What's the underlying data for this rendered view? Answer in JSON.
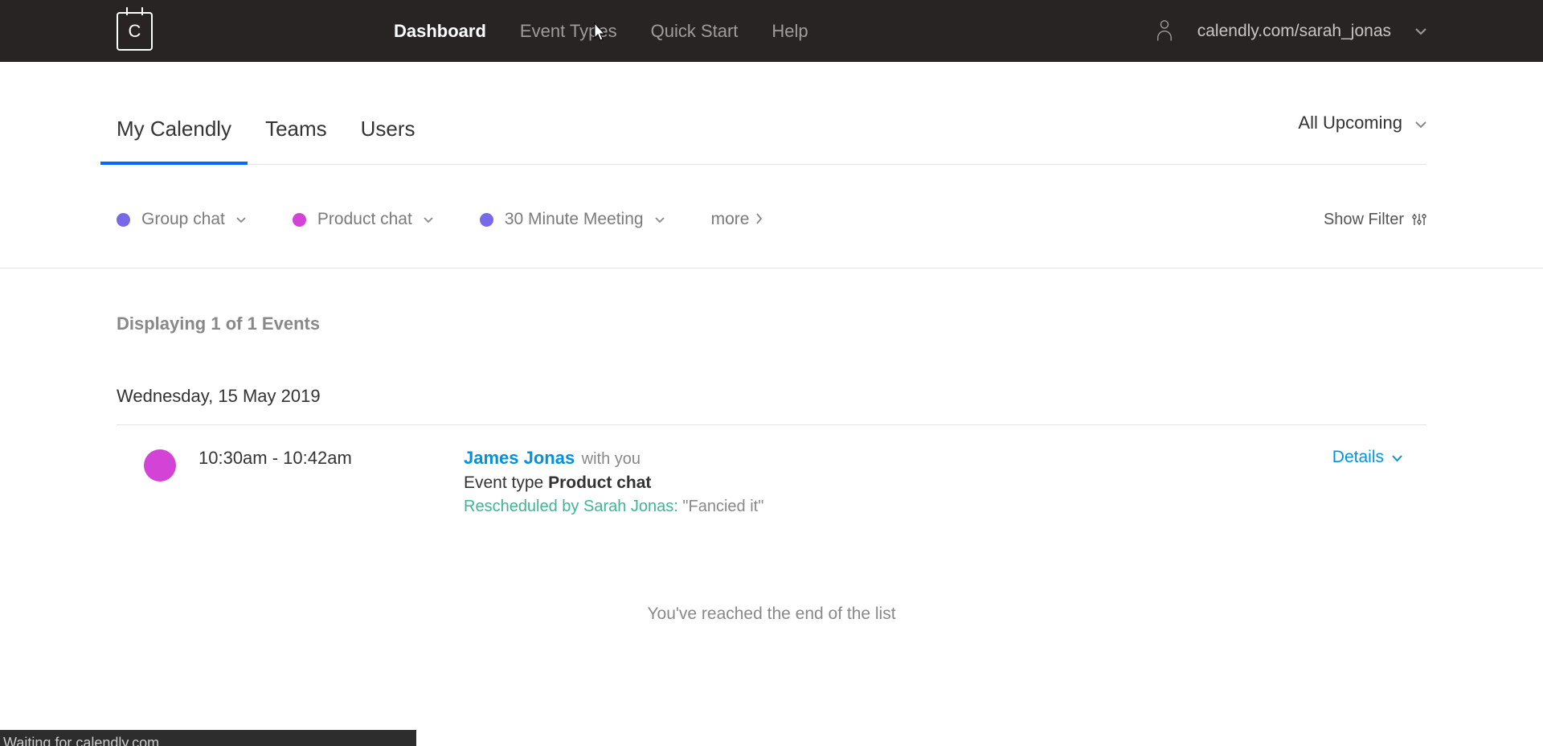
{
  "header": {
    "logo_letter": "C",
    "nav": [
      {
        "label": "Dashboard",
        "active": true
      },
      {
        "label": "Event Types",
        "active": false
      },
      {
        "label": "Quick Start",
        "active": false
      },
      {
        "label": "Help",
        "active": false
      }
    ],
    "user_url": "calendly.com/sarah_jonas"
  },
  "tabs": [
    {
      "label": "My Calendly",
      "active": true
    },
    {
      "label": "Teams",
      "active": false
    },
    {
      "label": "Users",
      "active": false
    }
  ],
  "range_filter": "All Upcoming",
  "event_types": [
    {
      "label": "Group chat",
      "color": "purple"
    },
    {
      "label": "Product chat",
      "color": "magenta"
    },
    {
      "label": "30 Minute Meeting",
      "color": "purple"
    }
  ],
  "more_label": "more",
  "show_filter_label": "Show Filter",
  "display_count_text": "Displaying 1 of 1 Events",
  "date_header": "Wednesday, 15 May 2019",
  "event": {
    "time": "10:30am - 10:42am",
    "invitee": "James Jonas",
    "with_text": "with you",
    "type_prefix": "Event type",
    "type_name": "Product chat",
    "rescheduled_prefix": "Rescheduled by Sarah Jonas:",
    "rescheduled_reason": "\"Fancied it\"",
    "details_label": "Details",
    "dot_color": "magenta"
  },
  "end_of_list": "You've reached the end of the list",
  "status_bar": "Waiting for calendly.com..."
}
